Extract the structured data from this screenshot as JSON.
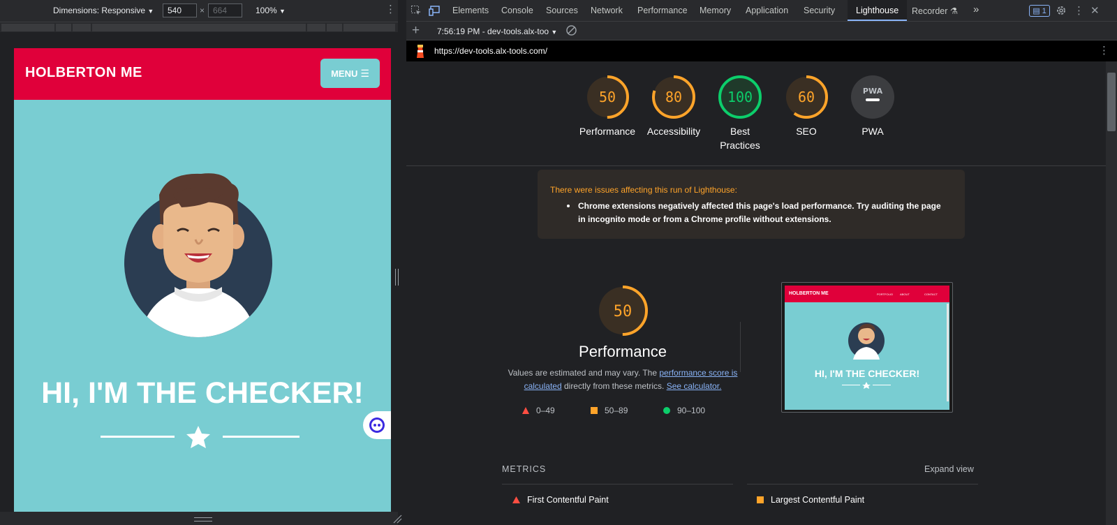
{
  "device_toolbar": {
    "dimensions_label": "Dimensions: Responsive",
    "width": "540",
    "height_placeholder": "664",
    "times": "×",
    "zoom": "100%"
  },
  "site": {
    "logo": "HOLBERTON ME",
    "menu": "MENU",
    "hero_title": "HI, I'M THE CHECKER!"
  },
  "devtools": {
    "tabs": [
      "Elements",
      "Console",
      "Sources",
      "Network",
      "Performance",
      "Memory",
      "Application",
      "Security",
      "Lighthouse",
      "Recorder"
    ],
    "active_tab": "Lighthouse",
    "issues_count": "1",
    "report_label": "7:56:19 PM - dev-tools.alx-too",
    "url": "https://dev-tools.alx-tools.com/"
  },
  "scores": [
    {
      "label": "Performance",
      "value": 50,
      "display": "50",
      "color": "#ffa42a"
    },
    {
      "label": "Accessibility",
      "value": 80,
      "display": "80",
      "color": "#ffa42a"
    },
    {
      "label": "Best Practices",
      "value": 100,
      "display": "100",
      "color": "#0cce6b"
    },
    {
      "label": "SEO",
      "value": 60,
      "display": "60",
      "color": "#ffa42a"
    },
    {
      "label": "PWA",
      "value": null,
      "display": "PWA",
      "color": "#9aa0a6"
    }
  ],
  "warning": {
    "title": "There were issues affecting this run of Lighthouse:",
    "item": "Chrome extensions negatively affected this page's load performance. Try auditing the page in incognito mode or from a Chrome profile without extensions."
  },
  "performance": {
    "score": "50",
    "title": "Performance",
    "desc_1": "Values are estimated and may vary. The ",
    "link_1": "performance score is calculated",
    "desc_2": " directly from these metrics. ",
    "link_2": "See calculator."
  },
  "legend": [
    {
      "range": "0–49",
      "color": "#ff4e42"
    },
    {
      "range": "50–89",
      "color": "#ffa42a"
    },
    {
      "range": "90–100",
      "color": "#0cce6b"
    }
  ],
  "thumbnail": {
    "logo": "HOLBERTON ME",
    "nav": [
      "PORTFOLIO",
      "ABOUT",
      "CONTACT"
    ],
    "hero_title": "HI, I'M THE CHECKER!"
  },
  "metrics": {
    "heading": "METRICS",
    "expand": "Expand view",
    "items": [
      {
        "label": "First Contentful Paint",
        "color": "#ff4e42"
      },
      {
        "label": "Largest Contentful Paint",
        "color": "#ffa42a"
      }
    ]
  }
}
